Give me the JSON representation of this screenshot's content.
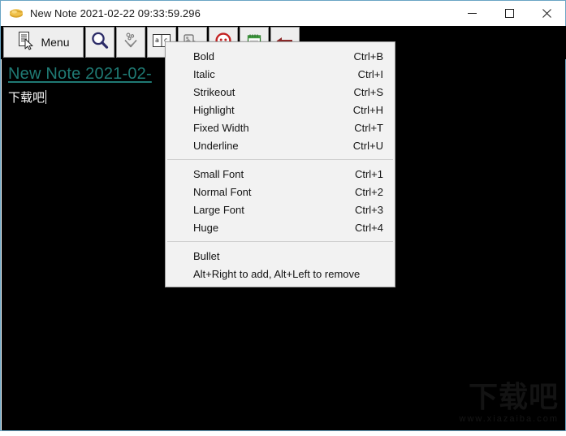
{
  "window": {
    "title": "New Note 2021-02-22 09:33:59.296",
    "icon": "note-icon",
    "controls": {
      "minimize": "minimize-icon",
      "maximize": "maximize-icon",
      "close": "close-icon"
    },
    "border_color": "#6aa5c4"
  },
  "toolbar": {
    "menu_label": "Menu",
    "buttons": [
      {
        "name": "menu-button",
        "icon": "document-cursor-icon",
        "label": "Menu"
      },
      {
        "name": "search-button",
        "icon": "magnifier-icon",
        "label": ""
      },
      {
        "name": "sort-button",
        "icon": "bubbles-sort-icon",
        "label": ""
      },
      {
        "name": "spellcheck-button",
        "icon": "a-c-text-icon",
        "label": ""
      },
      {
        "name": "attach-button",
        "icon": "stamp-tag-icon",
        "label": ""
      },
      {
        "name": "delete-button",
        "icon": "red-circle-face-icon",
        "label": ""
      },
      {
        "name": "new-note-button",
        "icon": "green-notepad-icon",
        "label": ""
      },
      {
        "name": "undo-button",
        "icon": "red-back-arrow-icon",
        "label": ""
      }
    ]
  },
  "note": {
    "title": "New Note 2021-02-",
    "title_color": "#1f7a74",
    "body": "下载吧",
    "body_color": "#ffffff",
    "background": "#000000"
  },
  "menu": {
    "groups": [
      {
        "items": [
          {
            "label": "Bold",
            "accel": "Ctrl+B"
          },
          {
            "label": "Italic",
            "accel": "Ctrl+I"
          },
          {
            "label": "Strikeout",
            "accel": "Ctrl+S"
          },
          {
            "label": "Highlight",
            "accel": "Ctrl+H"
          },
          {
            "label": "Fixed Width",
            "accel": "Ctrl+T"
          },
          {
            "label": "Underline",
            "accel": "Ctrl+U"
          }
        ]
      },
      {
        "items": [
          {
            "label": "Small Font",
            "accel": "Ctrl+1"
          },
          {
            "label": "Normal Font",
            "accel": "Ctrl+2"
          },
          {
            "label": "Large Font",
            "accel": "Ctrl+3"
          },
          {
            "label": "Huge",
            "accel": "Ctrl+4"
          }
        ]
      },
      {
        "items": [
          {
            "label": "Bullet",
            "accel": ""
          }
        ],
        "note": "Alt+Right to add, Alt+Left to remove"
      }
    ]
  },
  "watermark": {
    "main": "下载吧",
    "sub": "www.xiazaiba.com"
  }
}
